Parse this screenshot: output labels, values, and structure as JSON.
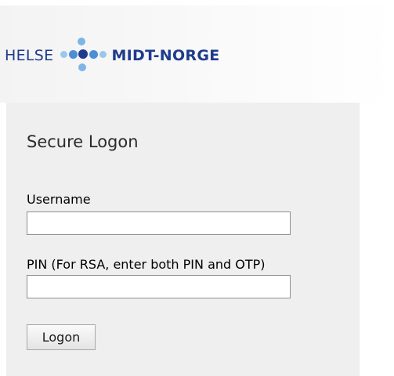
{
  "header": {
    "logo_left": "HELSE",
    "logo_right": "MIDT-NORGE"
  },
  "form": {
    "title": "Secure Logon",
    "username_label": "Username",
    "username_value": "",
    "pin_label": "PIN (For RSA, enter both PIN and OTP)",
    "pin_value": "",
    "logon_label": "Logon"
  },
  "colors": {
    "brand_navy": "#1f3b8c",
    "brand_light_blue": "#7fb4e6",
    "brand_blue": "#4a8fd6",
    "panel_bg": "#efefef"
  }
}
